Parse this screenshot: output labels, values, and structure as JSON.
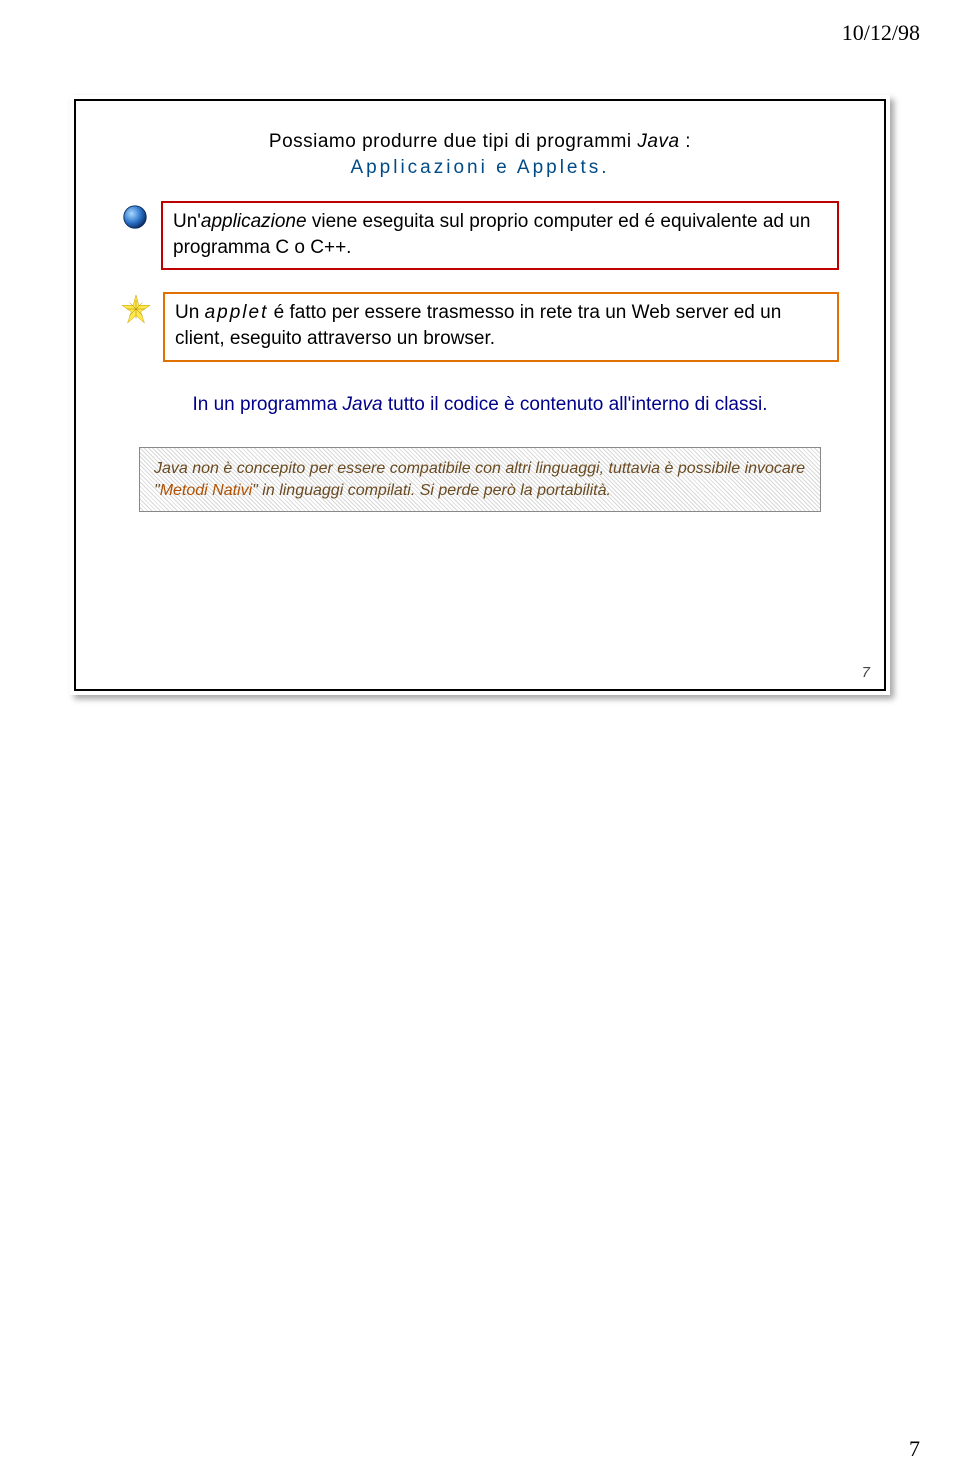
{
  "header": {
    "date": "10/12/98"
  },
  "slide": {
    "title_pre": "Possiamo produrre due tipi di programmi ",
    "title_java": "Java",
    "title_post": " :",
    "subtitle": "Applicazioni e Applets.",
    "box1": {
      "pre": "Un'",
      "em": "applicazione",
      "post": " viene eseguita sul proprio computer ed é equivalente ad un programma C o C++."
    },
    "box2": {
      "pre": "Un ",
      "em": "applet",
      "post": " é fatto per essere trasmesso in rete tra un Web server ed un client, eseguito attraverso un browser."
    },
    "statement": {
      "pre": "In un programma ",
      "java": "Java",
      "mid": " tutto il codice è contenuto all'interno di classi."
    },
    "footnote": {
      "pre": "Java",
      "text1": " non è concepito per essere compatibile con altri linguaggi, tuttavia è possibile invocare \"",
      "methods": "Metodi Nativi",
      "text2": "\" in linguaggi compilati. Si perde però la portabilità."
    },
    "page_num_inner": "7"
  },
  "page_num_outer": "7"
}
